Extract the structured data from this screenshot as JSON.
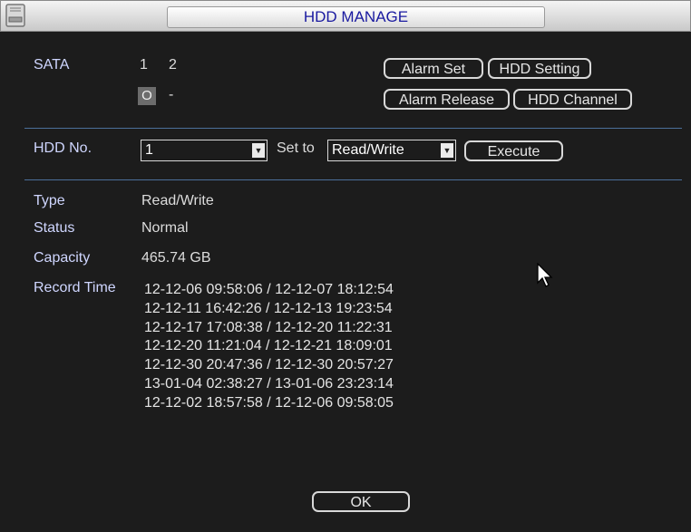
{
  "window": {
    "title": "HDD MANAGE"
  },
  "sata": {
    "label": "SATA",
    "ports": [
      "1",
      "2"
    ],
    "states": [
      "O",
      "-"
    ]
  },
  "buttons": {
    "alarm_set": "Alarm Set",
    "hdd_setting": "HDD Setting",
    "alarm_release": "Alarm Release",
    "hdd_channel": "HDD Channel",
    "execute": "Execute",
    "ok": "OK"
  },
  "hdd_no": {
    "label": "HDD No.",
    "value": "1"
  },
  "set_to": {
    "label": "Set to",
    "value": "Read/Write"
  },
  "info": {
    "type_label": "Type",
    "type_value": "Read/Write",
    "status_label": "Status",
    "status_value": "Normal",
    "capacity_label": "Capacity",
    "capacity_value": "465.74 GB",
    "record_time_label": "Record Time",
    "record_times": [
      "12-12-06 09:58:06 / 12-12-07 18:12:54",
      "12-12-11 16:42:26 / 12-12-13 19:23:54",
      "12-12-17 17:08:38 / 12-12-20 11:22:31",
      "12-12-20 11:21:04 / 12-12-21 18:09:01",
      "12-12-30 20:47:36 / 12-12-30 20:57:27",
      "13-01-04 02:38:27 / 13-01-06 23:23:14",
      "12-12-02 18:57:58 / 12-12-06 09:58:05"
    ]
  },
  "colors": {
    "background": "#1c1c1c",
    "label": "#cfd6ff",
    "separator": "#4c6f9a",
    "title_text": "#1a1aa0"
  }
}
